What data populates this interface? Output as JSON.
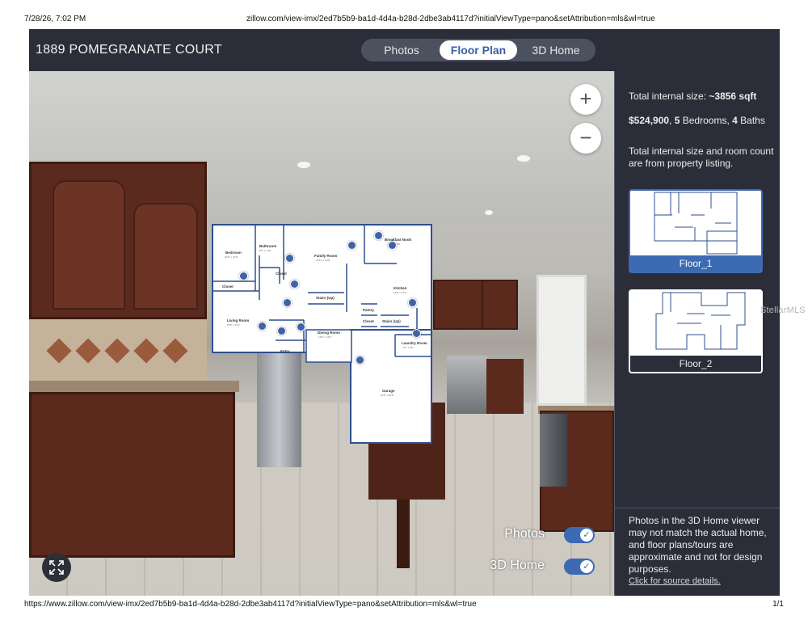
{
  "print": {
    "datetime": "7/28/26, 7:02 PM",
    "url_top": "zillow.com/view-imx/2ed7b5b9-ba1d-4d4a-b28d-2dbe3ab4117d?initialViewType=pano&setAttribution=mls&wl=true",
    "url_bottom": "https://www.zillow.com/view-imx/2ed7b5b9-ba1d-4d4a-b28d-2dbe3ab4117d?initialViewType=pano&setAttribution=mls&wl=true",
    "page": "1/1"
  },
  "header": {
    "address": "1889 POMEGRANATE COURT",
    "tabs": [
      {
        "label": "Photos",
        "selected": false
      },
      {
        "label": "Floor Plan",
        "selected": true
      },
      {
        "label": "3D Home",
        "selected": false
      }
    ]
  },
  "viewer": {
    "zoom_in": "+",
    "zoom_out": "−",
    "toggles": [
      {
        "label": "Photos",
        "enabled": true
      },
      {
        "label": "3D Home",
        "enabled": true
      }
    ],
    "check": "✓"
  },
  "floorplan": {
    "rooms": [
      {
        "name": "Bedroom",
        "size": "10'6\" x 13'3\""
      },
      {
        "name": "Bathroom",
        "size": "8'6\" x 7'10\""
      },
      {
        "name": "Family Room",
        "size": "21'11\" x 13'8\""
      },
      {
        "name": "Breakfast Nook",
        "size": "11'1\" x 8'0\""
      },
      {
        "name": "Closet",
        "size": ""
      },
      {
        "name": "Closet",
        "size": ""
      },
      {
        "name": "Stairs (Up)",
        "size": ""
      },
      {
        "name": "Kitchen",
        "size": "13'9\" x 12'0\""
      },
      {
        "name": "Living Room",
        "size": "15'5\" x 14'2\""
      },
      {
        "name": "Pantry",
        "size": ""
      },
      {
        "name": "Closet",
        "size": ""
      },
      {
        "name": "Stairs (Up)",
        "size": ""
      },
      {
        "name": "Dining Room",
        "size": "13'9\" x 13'2\""
      },
      {
        "name": "Laundry Room",
        "size": "8'7\" x 5'9\""
      },
      {
        "name": "Garage",
        "size": "19'6\" x 20'8\""
      },
      {
        "name": "Entry",
        "size": ""
      }
    ]
  },
  "sidebar": {
    "size_prefix": "Total internal size: ",
    "size_value": "~3856 sqft",
    "price": "$524,900",
    "price_sep": ", ",
    "bedrooms_count": "5",
    "bedrooms_label": " Bedrooms, ",
    "baths_count": "4",
    "baths_label": " Baths",
    "note": "Total internal size and room count are from property listing.",
    "floors": [
      {
        "label": "Floor_1",
        "selected": true
      },
      {
        "label": "Floor_2",
        "selected": false
      }
    ],
    "disclaimer": "Photos in the 3D Home viewer may not match the actual home, and floor plans/tours are approximate and not for design purposes.",
    "source_link": "Click for source details."
  },
  "watermark": "StellarMLS",
  "colors": {
    "accent": "#3c6ab3",
    "panel": "#2b2e39",
    "selected_tab_text": "#3a5fa8"
  }
}
